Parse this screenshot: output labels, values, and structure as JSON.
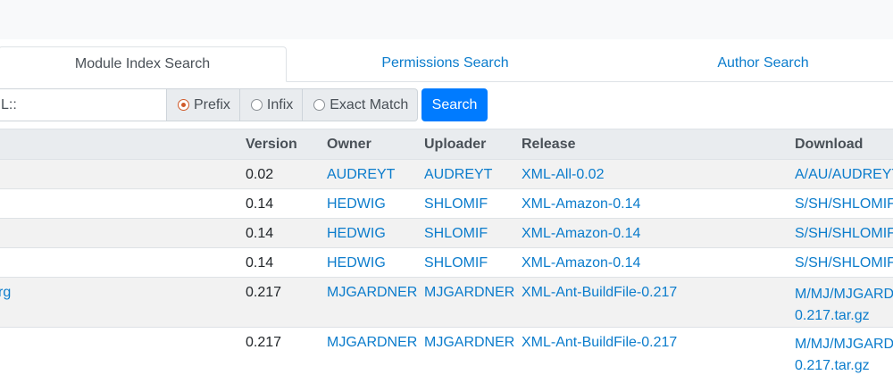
{
  "tabs": [
    {
      "label": "Module Index Search",
      "active": true
    },
    {
      "label": "Permissions Search",
      "active": false
    },
    {
      "label": "Author Search",
      "active": false
    }
  ],
  "search": {
    "value": "L::",
    "options": [
      {
        "label": "Prefix",
        "checked": true
      },
      {
        "label": "Infix",
        "checked": false
      },
      {
        "label": "Exact Match",
        "checked": false
      }
    ],
    "button_label": "Search"
  },
  "table": {
    "headers": [
      "Version",
      "Owner",
      "Uploader",
      "Release",
      "Download"
    ],
    "rows": [
      {
        "module": "",
        "version": "0.02",
        "owner": "AUDREYT",
        "uploader": "AUDREYT",
        "release": "XML-All-0.02",
        "download": "A/AU/AUDREYT"
      },
      {
        "module": "",
        "version": "0.14",
        "owner": "HEDWIG",
        "uploader": "SHLOMIF",
        "release": "XML-Amazon-0.14",
        "download": "S/SH/SHLOMIF/"
      },
      {
        "module": "",
        "version": "0.14",
        "owner": "HEDWIG",
        "uploader": "SHLOMIF",
        "release": "XML-Amazon-0.14",
        "download": "S/SH/SHLOMIF/"
      },
      {
        "module": "",
        "version": "0.14",
        "owner": "HEDWIG",
        "uploader": "SHLOMIF",
        "release": "XML-Amazon-0.14",
        "download": "S/SH/SHLOMIF/"
      },
      {
        "module": "rg",
        "version": "0.217",
        "owner": "MJGARDNER",
        "uploader": "MJGARDNER",
        "release": "XML-Ant-BuildFile-0.217",
        "download": "M/MJ/MJGARDN",
        "download_line2": "0.217.tar.gz"
      },
      {
        "module": "",
        "version": "0.217",
        "owner": "MJGARDNER",
        "uploader": "MJGARDNER",
        "release": "XML-Ant-BuildFile-0.217",
        "download": "M/MJ/MJGARDN",
        "download_line2": "0.217.tar.gz"
      }
    ]
  },
  "colors": {
    "accent": "#007bff",
    "link": "#0b7ccc",
    "radio_checked": "#d05a2a"
  }
}
